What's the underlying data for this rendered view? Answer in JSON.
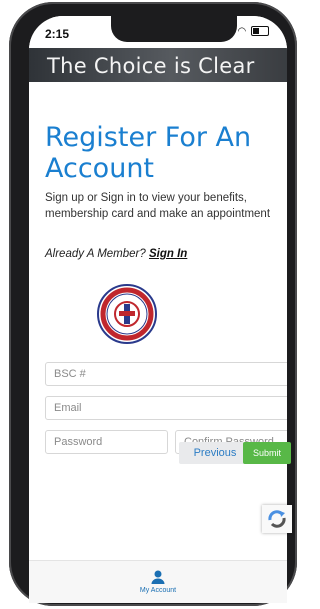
{
  "status_bar": {
    "time": "2:15",
    "signal": "..ıl ≋"
  },
  "banner": {
    "text": "The Choice is Clear"
  },
  "page": {
    "title": "Register For An Account",
    "description": "Sign up or Sign in to view your benefits, membership card and make an appointment",
    "already_member": "Already A Member?",
    "sign_in_link": "Sign In"
  },
  "form": {
    "bsc_placeholder": "BSC #",
    "email_placeholder": "Email",
    "password_placeholder": "Password",
    "confirm_password_placeholder": "Confirm Password",
    "previous_label": "Previous",
    "submit_label": "Submit"
  },
  "bottom_nav": {
    "my_account_label": "My Account",
    "icon": "user-icon"
  },
  "colors": {
    "heading": "#1a7fd0",
    "submit": "#58b847",
    "link": "#2b7cc4"
  }
}
